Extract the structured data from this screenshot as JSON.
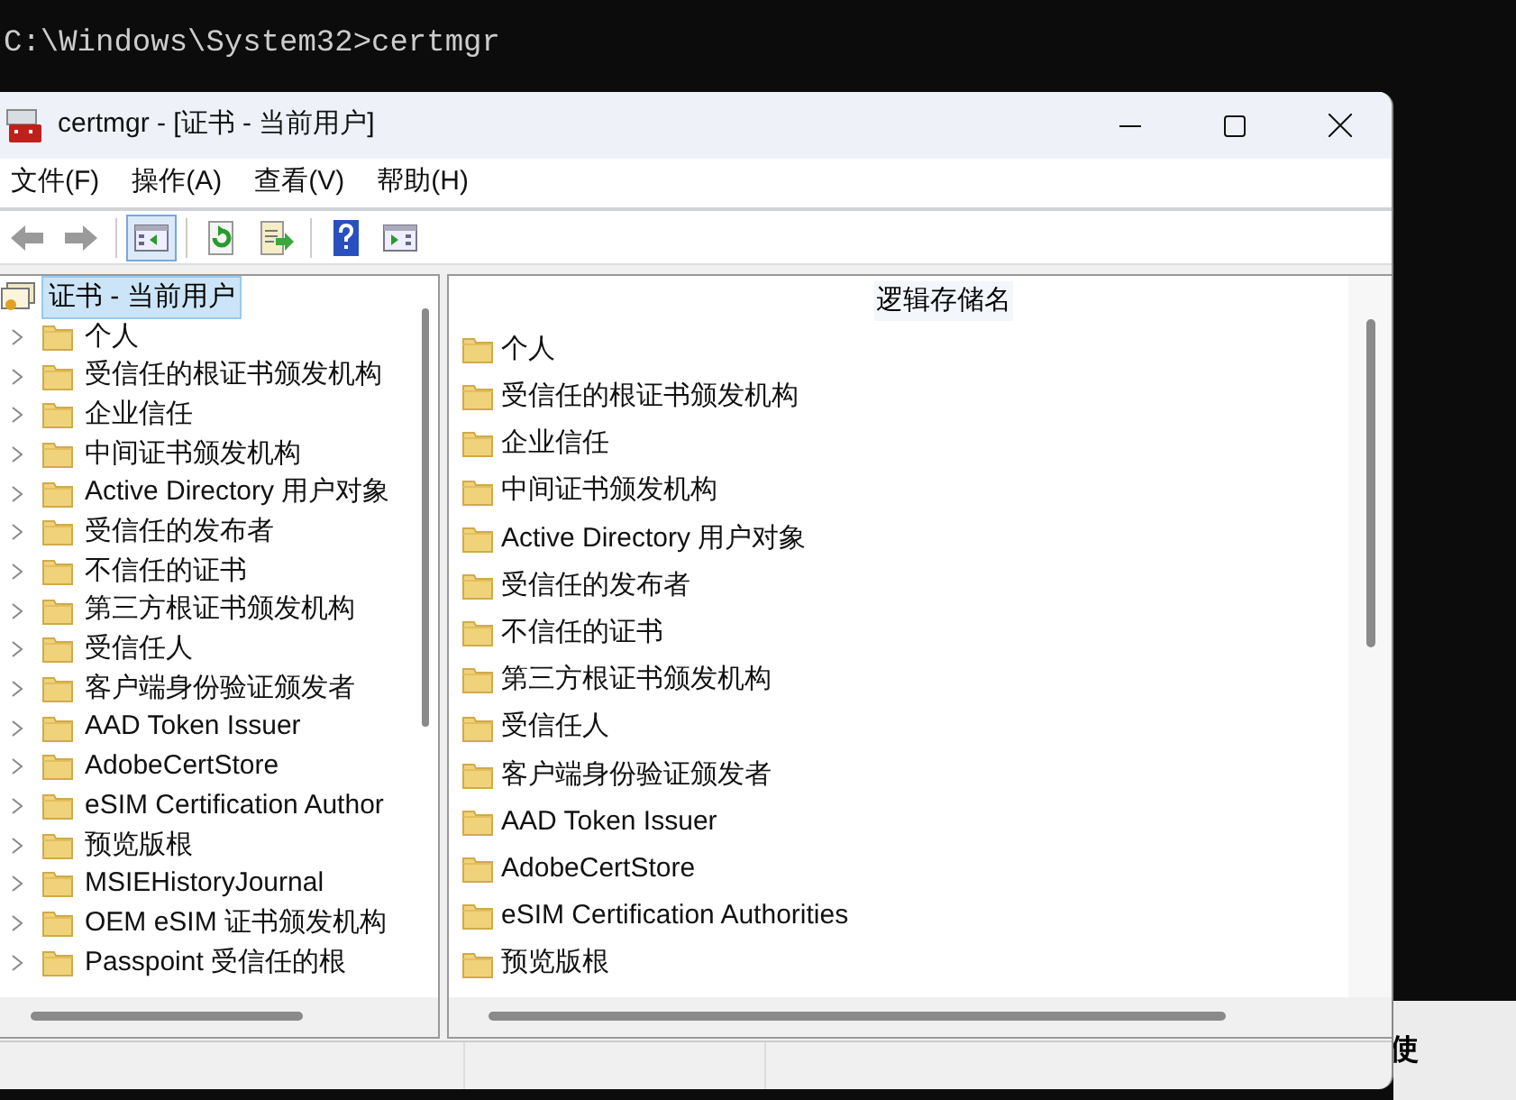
{
  "console": {
    "prompt_line": "C:\\Windows\\System32>certmgr"
  },
  "background_text": "使",
  "window": {
    "title": "certmgr - [证书 - 当前用户]"
  },
  "menu": [
    "文件(F)",
    "操作(A)",
    "查看(V)",
    "帮助(H)"
  ],
  "toolbar": [
    {
      "kind": "back",
      "selected": false
    },
    {
      "kind": "forward",
      "selected": false
    },
    {
      "kind": "tree",
      "selected": true
    },
    {
      "kind": "refresh",
      "selected": false
    },
    {
      "kind": "export",
      "selected": false
    },
    {
      "kind": "help",
      "selected": false
    },
    {
      "kind": "pane",
      "selected": false
    }
  ],
  "tree": {
    "root": {
      "label": "证书 - 当前用户",
      "selected": true
    },
    "children": [
      "个人",
      "受信任的根证书颁发机构",
      "企业信任",
      "中间证书颁发机构",
      "Active Directory 用户对象",
      "受信任的发布者",
      "不信任的证书",
      "第三方根证书颁发机构",
      "受信任人",
      "客户端身份验证颁发者",
      "AAD Token Issuer",
      "AdobeCertStore",
      "eSIM Certification Author",
      "预览版根",
      "MSIEHistoryJournal",
      "OEM eSIM 证书颁发机构",
      "Passpoint 受信任的根"
    ]
  },
  "list": {
    "column": "逻辑存储名",
    "items": [
      "个人",
      "受信任的根证书颁发机构",
      "企业信任",
      "中间证书颁发机构",
      "Active Directory 用户对象",
      "受信任的发布者",
      "不信任的证书",
      "第三方根证书颁发机构",
      "受信任人",
      "客户端身份验证颁发者",
      "AAD Token Issuer",
      "AdobeCertStore",
      "eSIM Certification Authorities",
      "预览版根"
    ]
  }
}
